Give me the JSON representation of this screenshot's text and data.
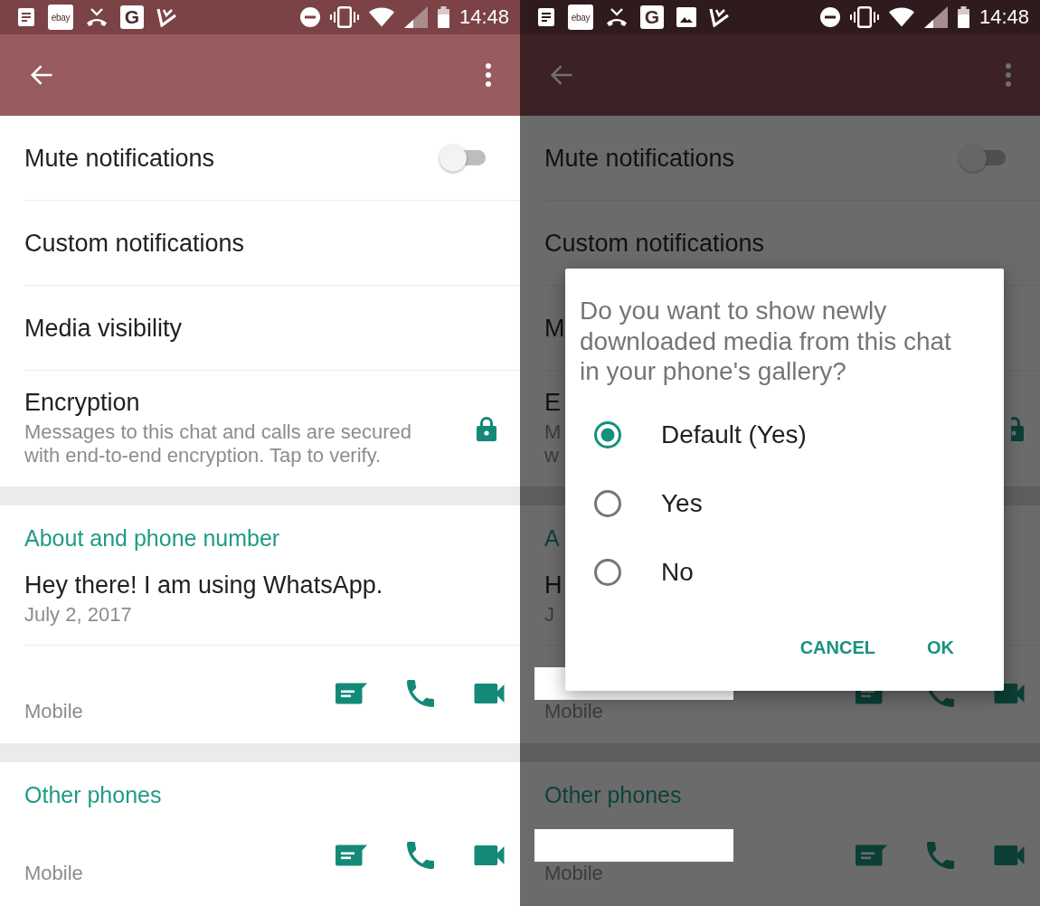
{
  "screens": [
    {
      "dimmed": false,
      "status_bar": {
        "notification_icons": [
          {
            "kind": "tray"
          },
          {
            "kind": "logo-tile",
            "label": "ebay"
          },
          {
            "kind": "missed-call"
          },
          {
            "kind": "letter-tile",
            "label": "G"
          },
          {
            "kind": "check"
          }
        ],
        "time": "14:48"
      },
      "settings": [
        {
          "kind": "toggle",
          "label": "Mute notifications",
          "on": false
        },
        {
          "kind": "plain",
          "label": "Custom notifications"
        },
        {
          "kind": "plain",
          "label": "Media visibility"
        },
        {
          "kind": "lock",
          "label": "Encryption",
          "description": "Messages to this chat and calls are secured\nwith end-to-end encryption. Tap to verify."
        }
      ],
      "sections": [
        {
          "header": "About and phone number",
          "status": "Hey there! I am using WhatsApp.",
          "date": "July 2, 2017",
          "phones": [
            {
              "label": "Mobile"
            }
          ]
        },
        {
          "header": "Other phones",
          "phones": [
            {
              "label": "Mobile"
            }
          ]
        }
      ]
    },
    {
      "dimmed": true,
      "status_bar": {
        "notification_icons": [
          {
            "kind": "tray"
          },
          {
            "kind": "logo-tile",
            "label": "ebay"
          },
          {
            "kind": "missed-call"
          },
          {
            "kind": "letter-tile",
            "label": "G"
          },
          {
            "kind": "image"
          },
          {
            "kind": "check"
          }
        ],
        "time": "14:48"
      },
      "settings": [
        {
          "kind": "toggle",
          "label": "Mute notifications",
          "on": false
        },
        {
          "kind": "plain",
          "label": "Custom notifications"
        },
        {
          "kind": "plain",
          "label": "M"
        },
        {
          "kind": "lock",
          "label": "E",
          "description": "M\nw"
        }
      ],
      "sections": [
        {
          "header": "A",
          "status": "H",
          "date": "J",
          "phones": [
            {
              "label": "Mobile",
              "redacted": true
            }
          ]
        },
        {
          "header": "Other phones",
          "phones": [
            {
              "label": "Mobile",
              "redacted": true
            }
          ]
        }
      ],
      "dialog": {
        "message": "Do you want to show newly downloaded media from this chat in your phone's gallery?",
        "options": [
          {
            "label": "Default (Yes)",
            "selected": true
          },
          {
            "label": "Yes",
            "selected": false
          },
          {
            "label": "No",
            "selected": false
          }
        ],
        "buttons": [
          "CANCEL",
          "OK"
        ]
      }
    }
  ]
}
